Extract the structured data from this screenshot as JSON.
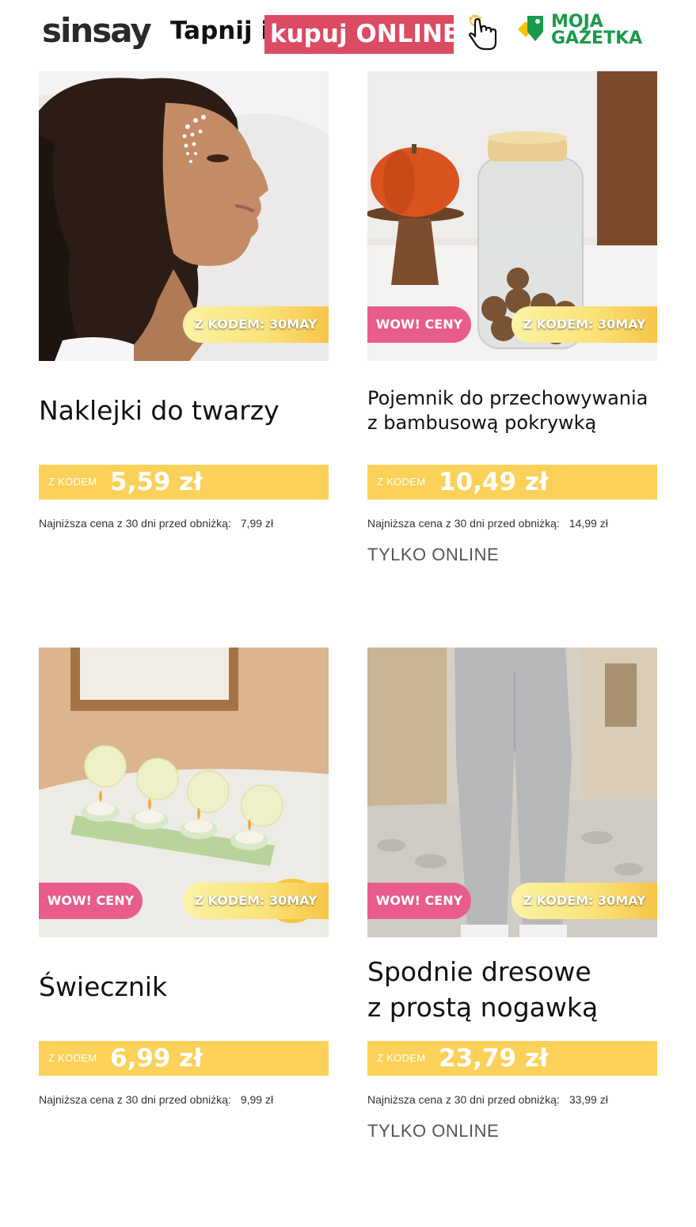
{
  "header": {
    "logo": "sinsay",
    "tap_text": "Tapnij i",
    "tap_highlight": "kupuj ONLINE",
    "gazetka_line1": "MOJA",
    "gazetka_line2": "GAZETKA"
  },
  "colors": {
    "brand_pink": "#dc4a63",
    "wow_badge": "#e85d8c",
    "price_bar": "#fcd15a",
    "gazetka_green": "#1a9a4b"
  },
  "products": [
    {
      "title_lines": [
        "Naklejki do twarzy"
      ],
      "badges": [
        "Z KODEM: 30MAY"
      ],
      "price_prefix": "Z KODEM",
      "price": "5,59 zł",
      "lowest_label": "Najniższa cena z 30 dni przed obniżką:",
      "lowest_price": "7,99 zł",
      "online_only": ""
    },
    {
      "title_lines": [
        "Pojemnik do przechowywania",
        "z bambusową pokrywką"
      ],
      "badges": [
        "WOW! CENY",
        "Z KODEM: 30MAY"
      ],
      "price_prefix": "Z KODEM",
      "price": "10,49 zł",
      "lowest_label": "Najniższa cena z 30 dni przed obniżką:",
      "lowest_price": "14,99 zł",
      "online_only": "TYLKO ONLINE"
    },
    {
      "title_lines": [
        "Świecznik"
      ],
      "badges": [
        "WOW! CENY",
        "Z KODEM: 30MAY"
      ],
      "price_prefix": "Z KODEM",
      "price": "6,99 zł",
      "lowest_label": "Najniższa cena z 30 dni przed obniżką:",
      "lowest_price": "9,99 zł",
      "online_only": ""
    },
    {
      "title_lines": [
        "Spodnie dresowe",
        "z prostą nogawką"
      ],
      "badges": [
        "WOW! CENY",
        "Z KODEM: 30MAY"
      ],
      "price_prefix": "Z KODEM",
      "price": "23,79 zł",
      "lowest_label": "Najniższa cena z 30 dni przed obniżką:",
      "lowest_price": "33,99 zł",
      "online_only": "TYLKO ONLINE"
    }
  ]
}
